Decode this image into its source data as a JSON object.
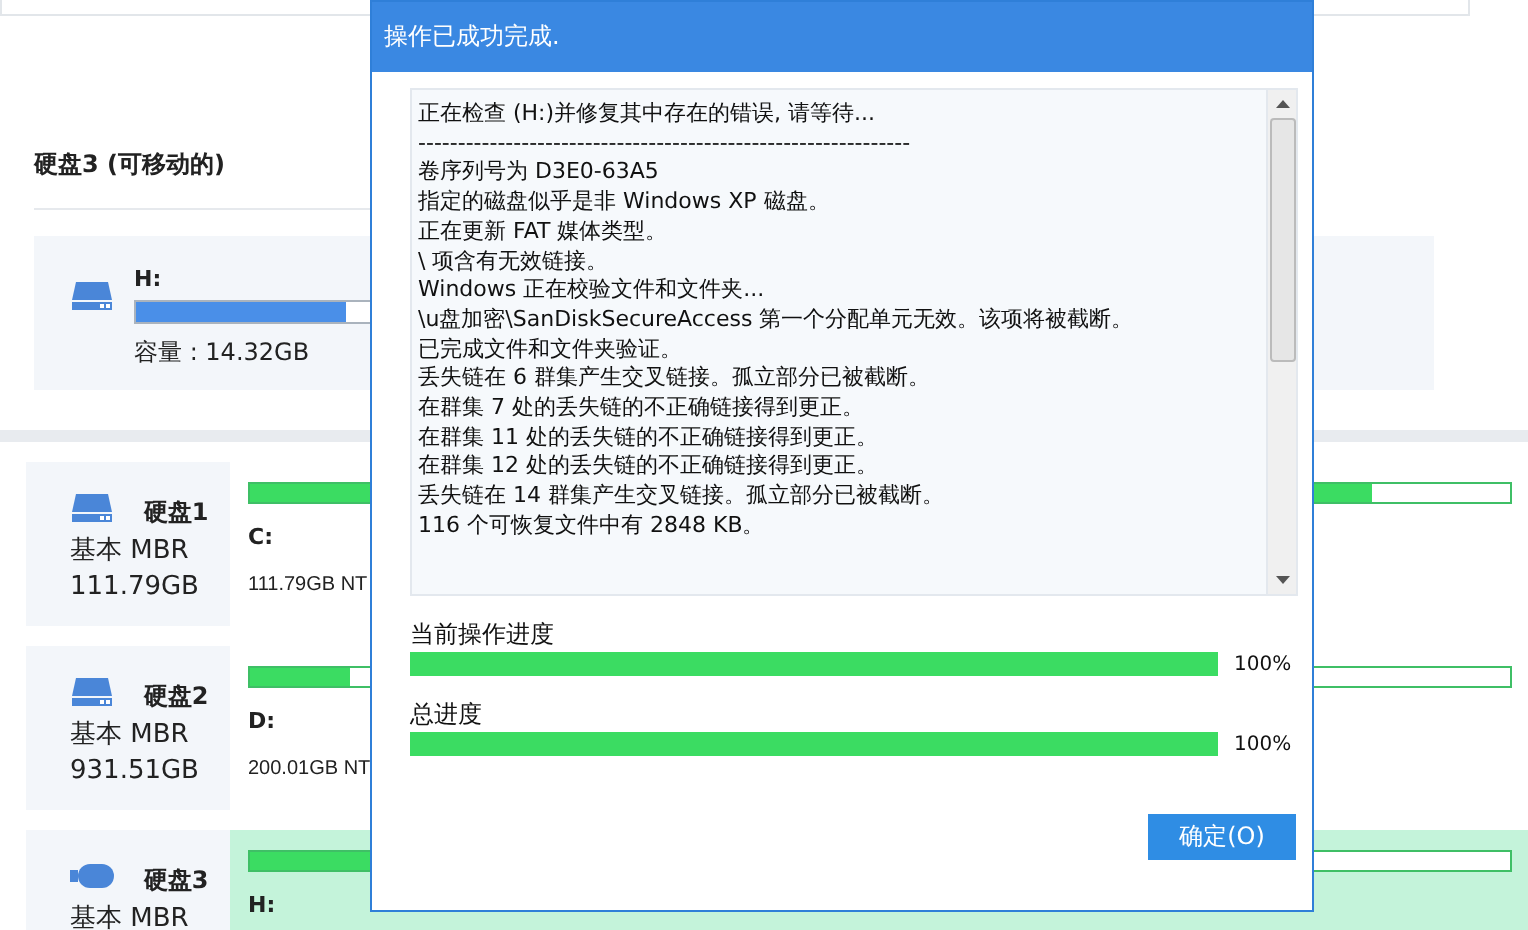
{
  "removable_section": {
    "title": "硬盘3 (可移动的)",
    "device": {
      "drive": "H:",
      "level": 0.35,
      "capacity": "容量 : 14.32GB"
    }
  },
  "disks": [
    {
      "kind": "hdd",
      "name": "硬盘1",
      "type": "基本 MBR",
      "size": "111.79GB",
      "selected": false,
      "partition": {
        "drive": "C:",
        "level": 0.89,
        "info": "111.79GB NT"
      }
    },
    {
      "kind": "hdd",
      "name": "硬盘2",
      "type": "基本 MBR",
      "size": "931.51GB",
      "selected": false,
      "partition": {
        "drive": "D:",
        "level": 0.08,
        "info": "200.01GB NT"
      }
    },
    {
      "kind": "usb",
      "name": "硬盘3",
      "type": "基本 MBR",
      "selected": true,
      "partition": {
        "drive": "H:",
        "level": 0.5
      }
    }
  ],
  "dialog": {
    "title": "操作已成功完成.",
    "log": [
      "正在检查 (H:)并修复其中存在的错误, 请等待...",
      "--------------------------------------------------------------",
      "卷序列号为 D3E0-63A5",
      "指定的磁盘似乎是非 Windows XP 磁盘。",
      "正在更新 FAT 媒体类型。",
      "\\ 项含有无效链接。",
      "Windows 正在校验文件和文件夹...",
      "\\u盘加密\\SanDiskSecureAccess 第一个分配单元无效。该项将被截断。",
      "已完成文件和文件夹验证。",
      "丢失链在 6 群集产生交叉链接。孤立部分已被截断。",
      "在群集 7 处的丢失链的不正确链接得到更正。",
      "在群集 11 处的丢失链的不正确链接得到更正。",
      "在群集 12 处的丢失链的不正确链接得到更正。",
      "丢失链在 14 群集产生交叉链接。孤立部分已被截断。",
      "116 个可恢复文件中有 2848 KB。"
    ],
    "progress": [
      {
        "label": "当前操作进度",
        "level": 1,
        "reading": "100%"
      },
      {
        "label": "总进度",
        "level": 1,
        "reading": "100%"
      }
    ],
    "button": "确定(O)"
  }
}
